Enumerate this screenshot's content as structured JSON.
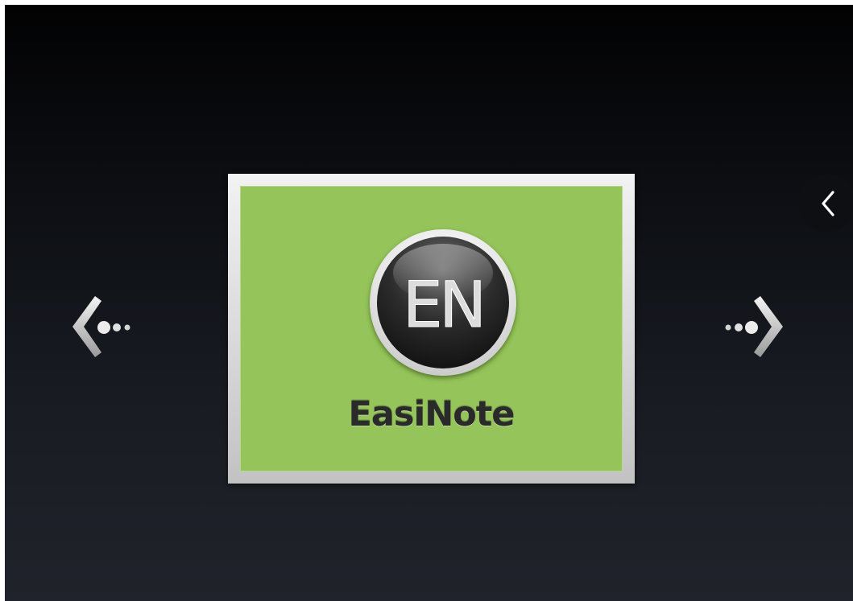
{
  "app_tile": {
    "name": "EasiNote",
    "logo_text": "EN",
    "tile_color": "#94c45a"
  },
  "navigation": {
    "prev_icon": "arrow-left-dots-icon",
    "next_icon": "arrow-right-dots-icon",
    "back_icon": "chevron-left-icon"
  },
  "colors": {
    "background_top": "#020203",
    "background_bottom": "#20232b",
    "frame": "#d9d9d9"
  }
}
